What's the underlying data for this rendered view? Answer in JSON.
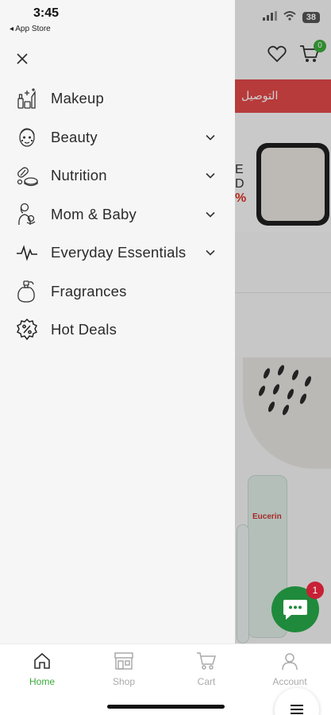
{
  "status": {
    "time": "3:45",
    "back_label": "◂ App Store",
    "battery": "38"
  },
  "drawer": {
    "close_icon": "close-icon",
    "items": [
      {
        "label": "Makeup",
        "icon": "makeup-icon",
        "has_chevron": false
      },
      {
        "label": "Beauty",
        "icon": "beauty-face-icon",
        "has_chevron": true
      },
      {
        "label": "Nutrition",
        "icon": "nutrition-icon",
        "has_chevron": true
      },
      {
        "label": "Mom & Baby",
        "icon": "mom-baby-icon",
        "has_chevron": true
      },
      {
        "label": "Everyday Essentials",
        "icon": "pulse-icon",
        "has_chevron": true
      },
      {
        "label": "Fragrances",
        "icon": "perfume-icon",
        "has_chevron": false
      },
      {
        "label": "Hot Deals",
        "icon": "discount-badge-icon",
        "has_chevron": false
      }
    ]
  },
  "background": {
    "promo_text": "التوصيل",
    "cart_count": "0",
    "banner_letters": [
      "E",
      "D"
    ],
    "banner_percent": "%",
    "product_brand": "Eucerin"
  },
  "chat": {
    "badge": "1"
  },
  "tabbar": {
    "tabs": [
      {
        "label": "Home",
        "icon": "home-icon",
        "active": true
      },
      {
        "label": "Shop",
        "icon": "shop-icon",
        "active": false
      },
      {
        "label": "Cart",
        "icon": "cart-icon",
        "active": false
      },
      {
        "label": "Account",
        "icon": "account-icon",
        "active": false
      }
    ]
  },
  "colors": {
    "accent": "#3aaa3a",
    "promo": "#e04848",
    "chat": "#1f8a3b",
    "badge": "#c82035"
  }
}
